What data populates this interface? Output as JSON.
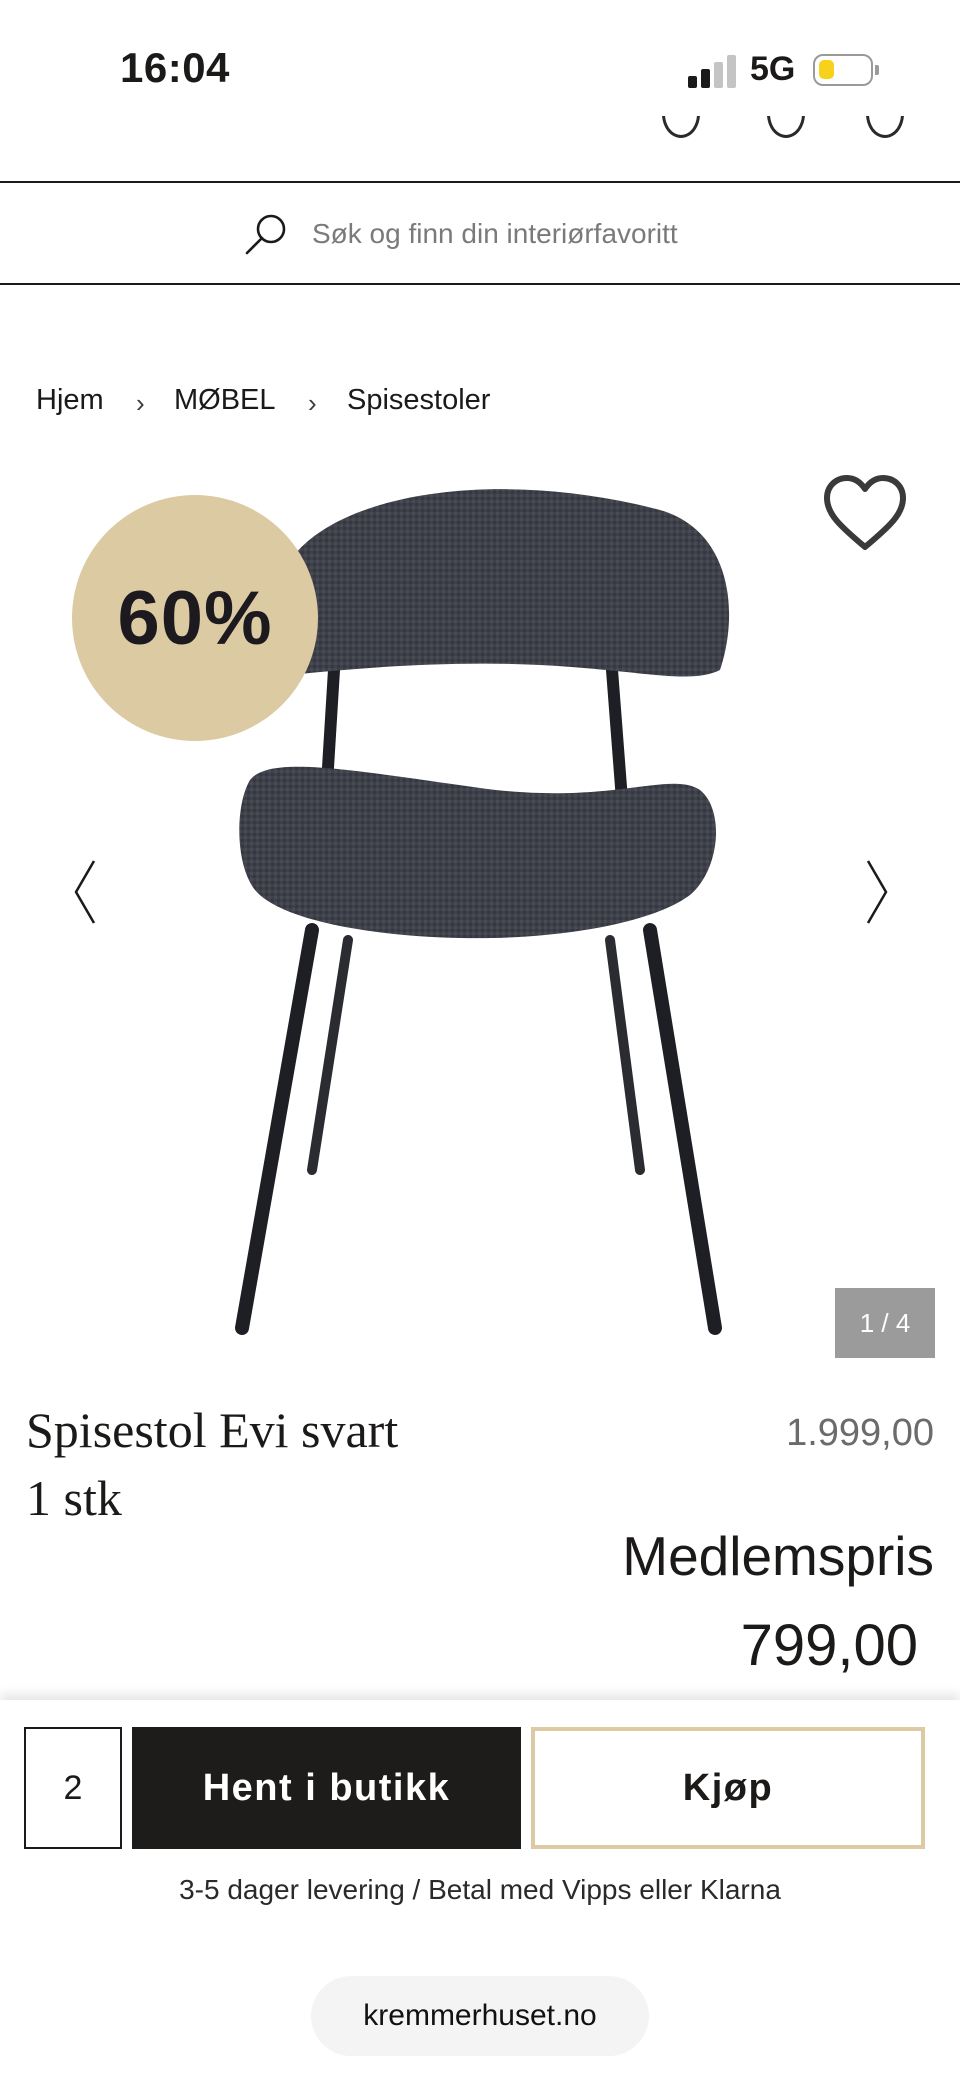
{
  "status_bar": {
    "time": "16:04",
    "network": "5G"
  },
  "search": {
    "placeholder": "Søk og finn din interiørfavoritt"
  },
  "breadcrumb": [
    {
      "label": "Hjem"
    },
    {
      "label": "MØBEL"
    },
    {
      "label": "Spisestoler"
    }
  ],
  "product": {
    "discount_badge": "60%",
    "image_counter": "1 / 4",
    "title_line1": "Spisestol Evi svart",
    "title_line2": "1 stk",
    "original_price": "1.999,00",
    "member_label": "Medlemspris",
    "member_price": "799,00"
  },
  "purchase": {
    "quantity": "2",
    "store_button": "Hent i butikk",
    "buy_button": "Kjøp",
    "delivery_info": "3-5 dager levering / Betal med Vipps eller Klarna"
  },
  "browser": {
    "url": "kremmerhuset.no"
  },
  "colors": {
    "accent_beige": "#dccaa3",
    "dark": "#1e1c1a",
    "counter_gray": "#9b9b9b"
  },
  "icons": [
    "search-icon",
    "heart-icon",
    "chevron-left-icon",
    "chevron-right-icon",
    "chevron-right-icon-small"
  ]
}
